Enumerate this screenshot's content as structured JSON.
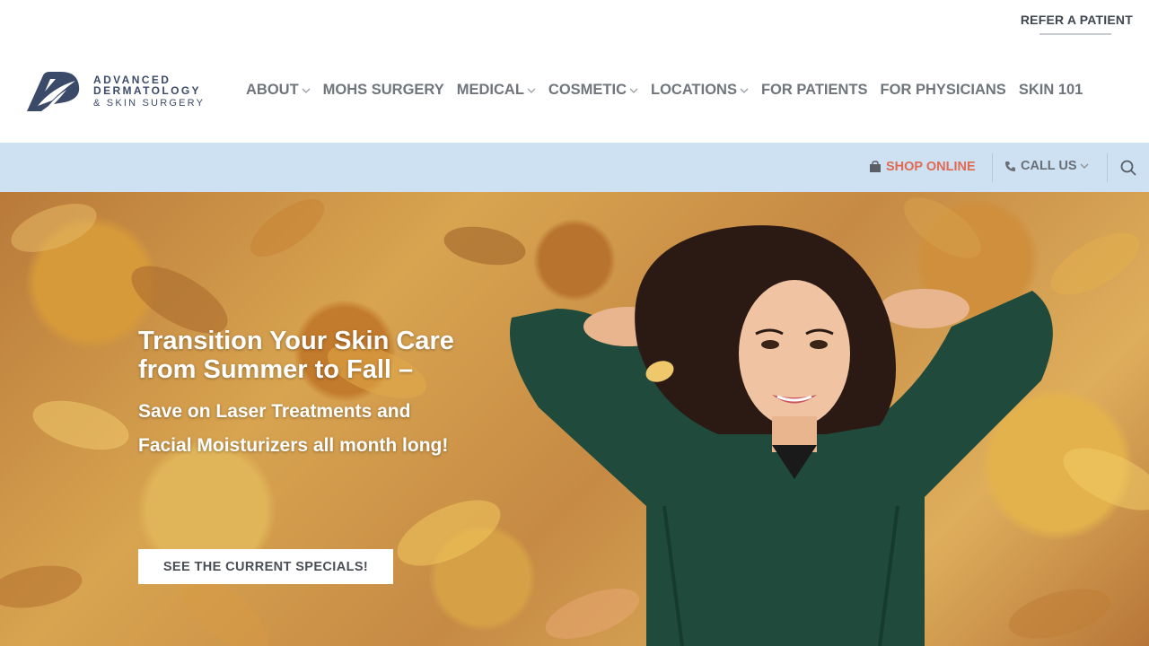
{
  "topbar": {
    "refer_label": "REFER A PATIENT"
  },
  "logo": {
    "line1": "ADVANCED",
    "line2": "DERMATOLOGY",
    "line3": "& SKIN SURGERY"
  },
  "nav": {
    "items": [
      {
        "label": "ABOUT",
        "has_dropdown": true
      },
      {
        "label": "MOHS SURGERY",
        "has_dropdown": false
      },
      {
        "label": "MEDICAL",
        "has_dropdown": true
      },
      {
        "label": "COSMETIC",
        "has_dropdown": true
      },
      {
        "label": "LOCATIONS",
        "has_dropdown": true
      },
      {
        "label": "FOR PATIENTS",
        "has_dropdown": false
      },
      {
        "label": "FOR PHYSICIANS",
        "has_dropdown": false
      },
      {
        "label": "SKIN 101",
        "has_dropdown": false
      }
    ]
  },
  "subbar": {
    "shop_label": "SHOP ONLINE",
    "call_label": "CALL US",
    "icons": [
      "shopping-bag-icon",
      "phone-icon",
      "chevron-down-icon",
      "search-icon"
    ]
  },
  "hero": {
    "title": "Transition Your Skin Care from Summer to Fall –",
    "subtitle": "Save on Laser Treatments and Facial Moisturizers all month long!",
    "cta_label": "SEE THE CURRENT SPECIALS!"
  },
  "colors": {
    "nav_text": "#70757c",
    "subbar_bg": "#cde1f3",
    "shop_accent": "#e06a52",
    "logo_blue": "#3c4a6a"
  }
}
